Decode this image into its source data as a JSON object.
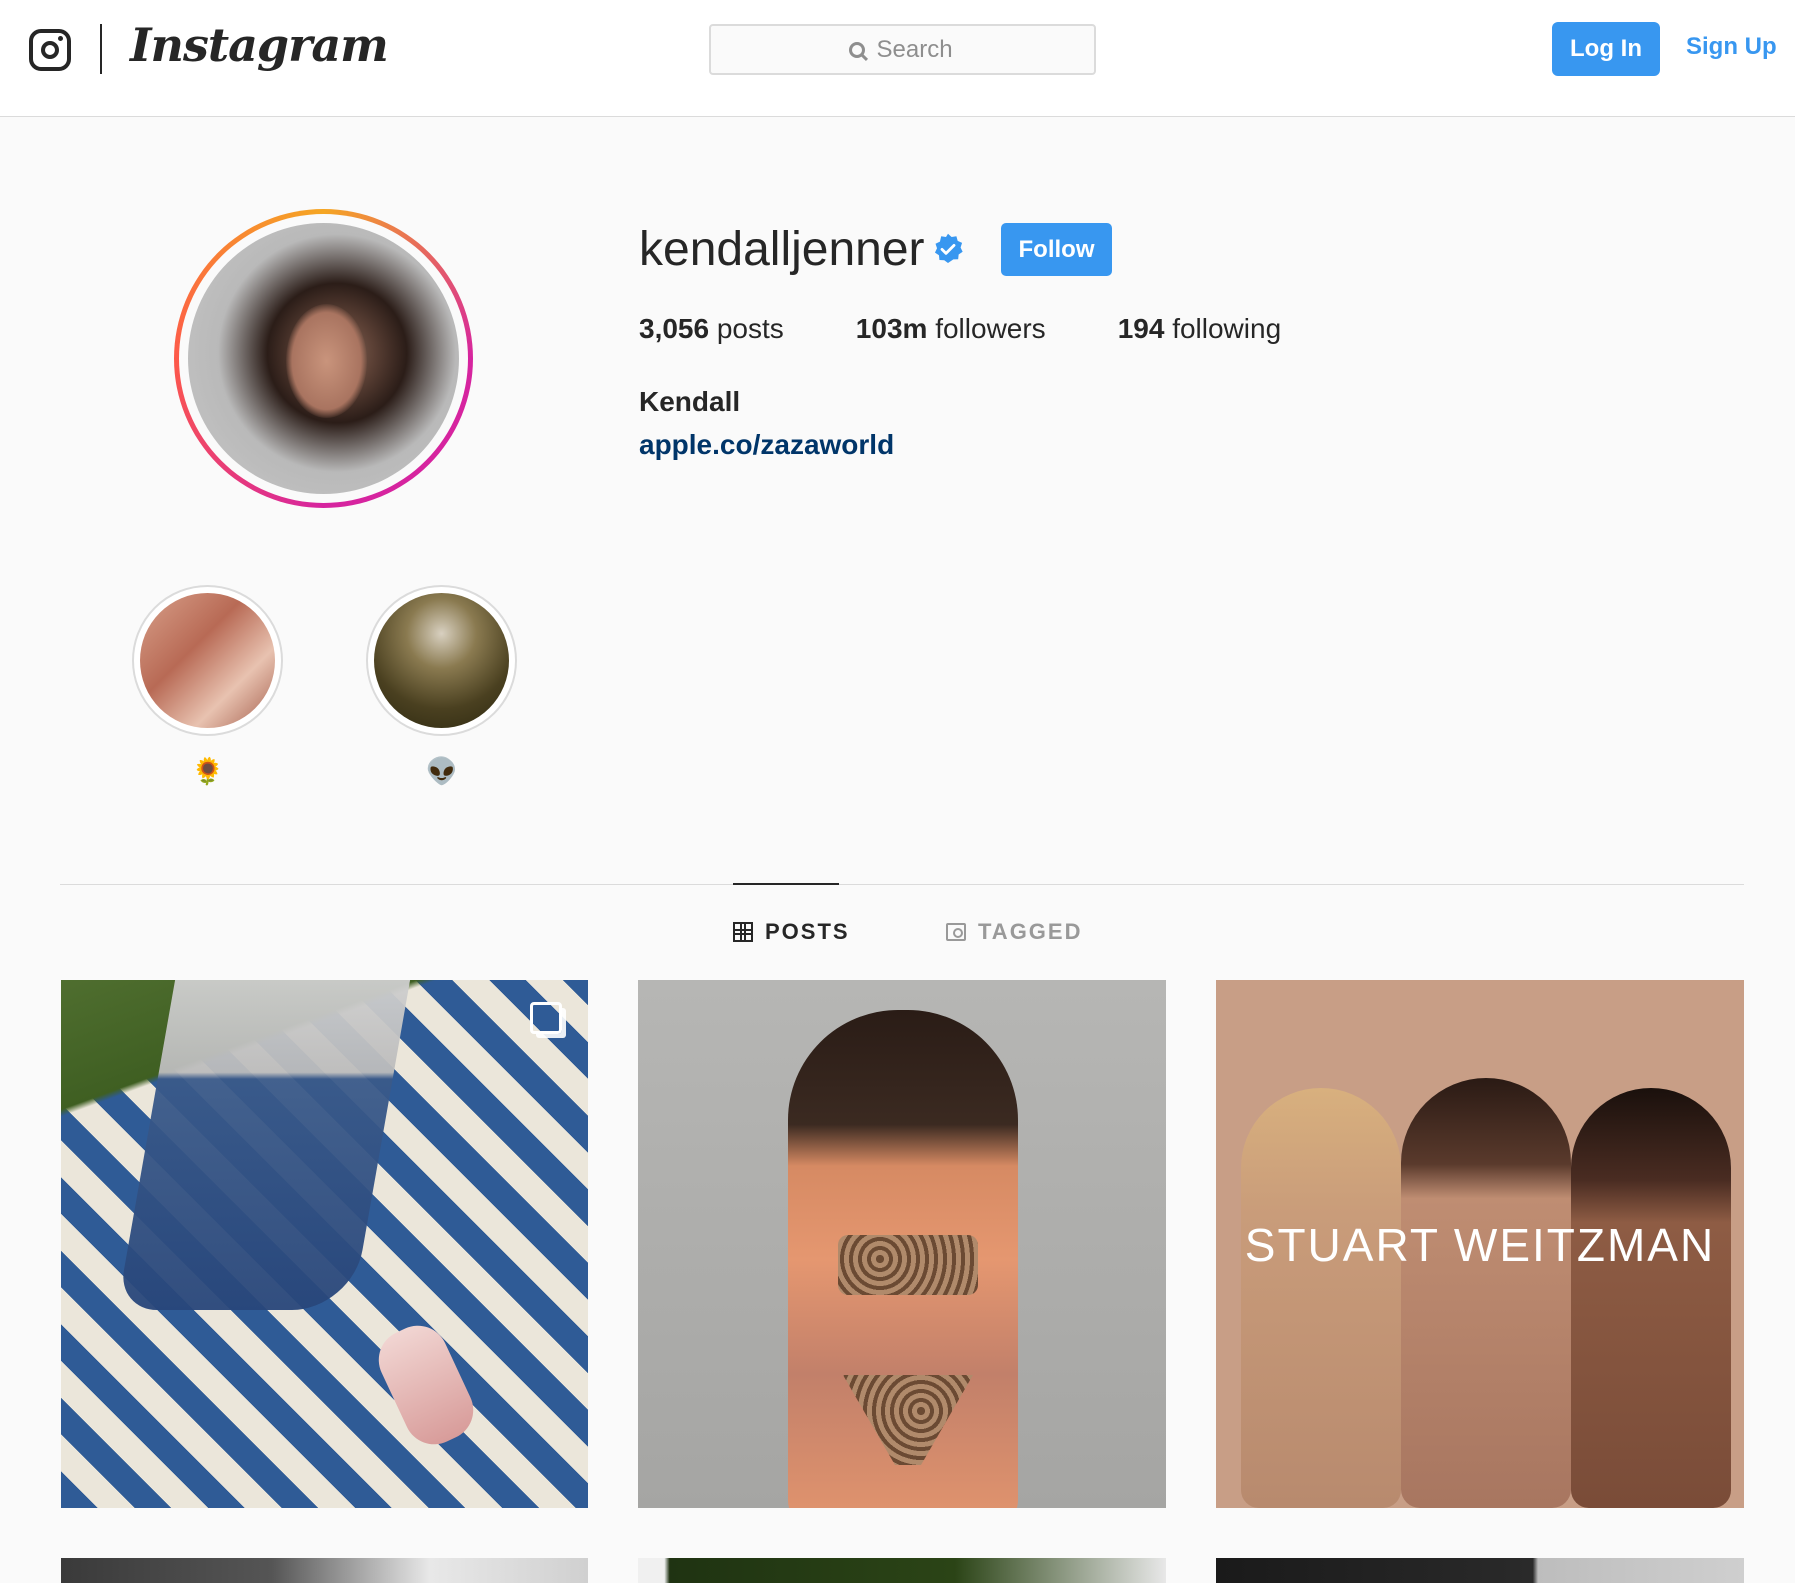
{
  "header": {
    "brand": "Instagram",
    "search_placeholder": "Search",
    "login_label": "Log In",
    "signup_label": "Sign Up"
  },
  "profile": {
    "username": "kendalljenner",
    "verified": true,
    "follow_label": "Follow",
    "stats": {
      "posts_count": "3,056",
      "posts_label": "posts",
      "followers_count": "103m",
      "followers_label": "followers",
      "following_count": "194",
      "following_label": "following"
    },
    "full_name": "Kendall",
    "bio_link": "apple.co/zazaworld"
  },
  "highlights": [
    {
      "label": "🌻"
    },
    {
      "label": "👽"
    }
  ],
  "tabs": {
    "posts": "POSTS",
    "tagged": "TAGGED",
    "active": "posts"
  },
  "posts": [
    {
      "multi": true
    },
    {
      "multi": false
    },
    {
      "multi": false,
      "overlay_text": "STUART WEITZMAN"
    }
  ],
  "colors": {
    "accent": "#3897f0",
    "link": "#003569",
    "border": "#dbdbdb",
    "background": "#fafafa"
  },
  "icons": [
    "instagram-camera-icon",
    "search-icon",
    "verified-badge-icon",
    "grid-icon",
    "tagged-icon",
    "multiple-images-icon"
  ]
}
